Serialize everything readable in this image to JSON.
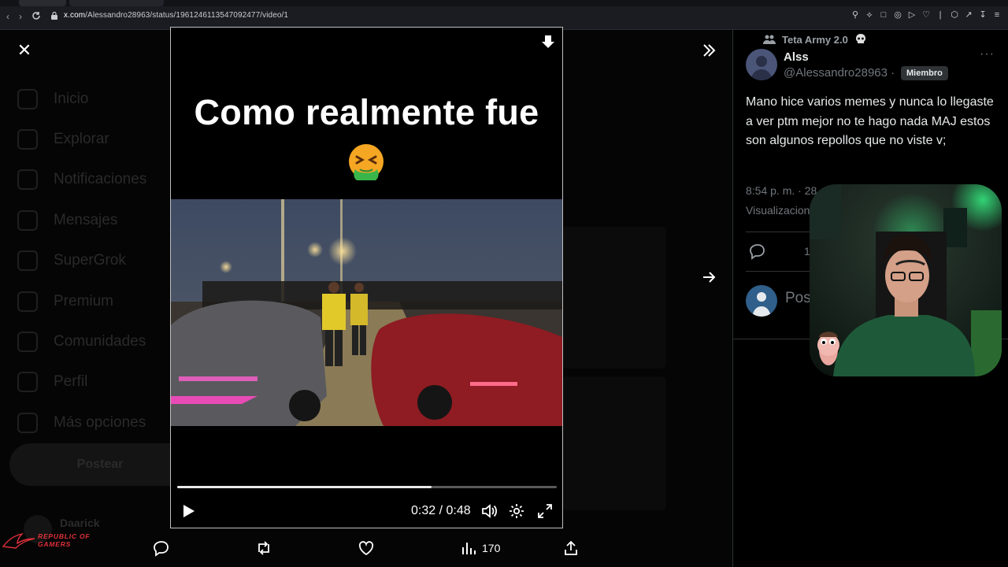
{
  "browser": {
    "url_host": "x.com",
    "url_path": "/Alessandro28963/status/1961246113547092477/video/1"
  },
  "background_nav": {
    "items": [
      "Inicio",
      "Explorar",
      "Notificaciones",
      "Mensajes",
      "SuperGrok",
      "Premium",
      "Comunidades",
      "Perfil",
      "Más opciones"
    ],
    "post_button": "Postear",
    "user_name": "Daarick"
  },
  "video": {
    "caption": "Como realmente fue",
    "current_time": "0:32",
    "duration": "0:48",
    "time_display": "0:32 / 0:48",
    "progress": 0.67
  },
  "actions": {
    "views_count": "170"
  },
  "tweet": {
    "community": "Teta Army 2.0",
    "author_name": "Alss",
    "author_handle": "@Alessandro28963 ·",
    "badge": "Miembro",
    "text": "Mano hice varios memes y nunca lo llegaste a ver ptm mejor no te hago nada MAJ estos son algunos repollos que no viste v;",
    "time": "8:54 p. m. · 28",
    "views_label": "Visualizacion",
    "reply_count": "1",
    "reply_placeholder": "Pos res"
  },
  "overlay": {
    "rog_line1": "REPUBLIC OF",
    "rog_line2": "GAMERS"
  },
  "colors": {
    "accent_red": "#e0303a",
    "text_primary": "#e7e9ea",
    "text_secondary": "#71767b"
  }
}
